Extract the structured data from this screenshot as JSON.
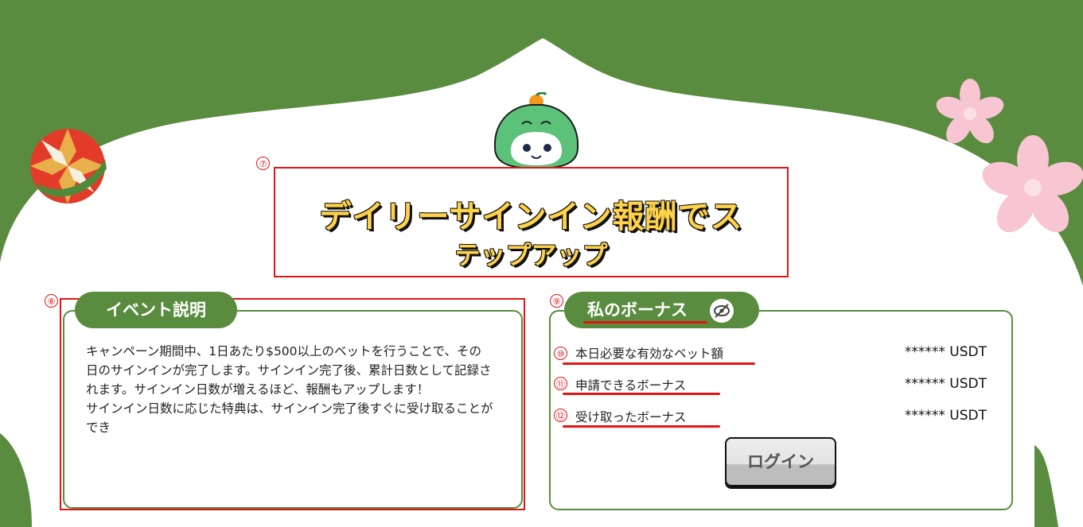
{
  "colors": {
    "green": "#5a8c3f",
    "red_annotation": "#e01515",
    "title_yellow": "#ffd24a"
  },
  "icons": {
    "mascot": "green-mascot-icon",
    "temari": "temari-ball-icon",
    "sakura": "sakura-flower-icon",
    "eye_hidden": "eye-off-icon"
  },
  "title": {
    "line1": "デイリーサインイン報酬でス",
    "line2": "テップアップ"
  },
  "markers": {
    "title": "⑦",
    "event": "⑧",
    "bonus": "⑨",
    "row1": "⑩",
    "row2": "⑪",
    "row3": "⑫"
  },
  "event": {
    "tab_label": "イベント説明",
    "text": "キャンペーン期間中、1日あたり$500以上のベットを行うことで、その日のサインインが完了します。サインイン完了後、累計日数として記録されます。サインイン日数が増えるほど、報酬もアップします！\nサインイン日数に応じた特典は、サインイン完了後すぐに受け取ることができ"
  },
  "bonus": {
    "tab_label": "私のボーナス",
    "rows": [
      {
        "label": "本日必要な有効なベット額",
        "value": "****** USDT"
      },
      {
        "label": "申請できるボーナス",
        "value": "****** USDT"
      },
      {
        "label": "受け取ったボーナス",
        "value": "****** USDT"
      }
    ],
    "login_label": "ログイン"
  }
}
